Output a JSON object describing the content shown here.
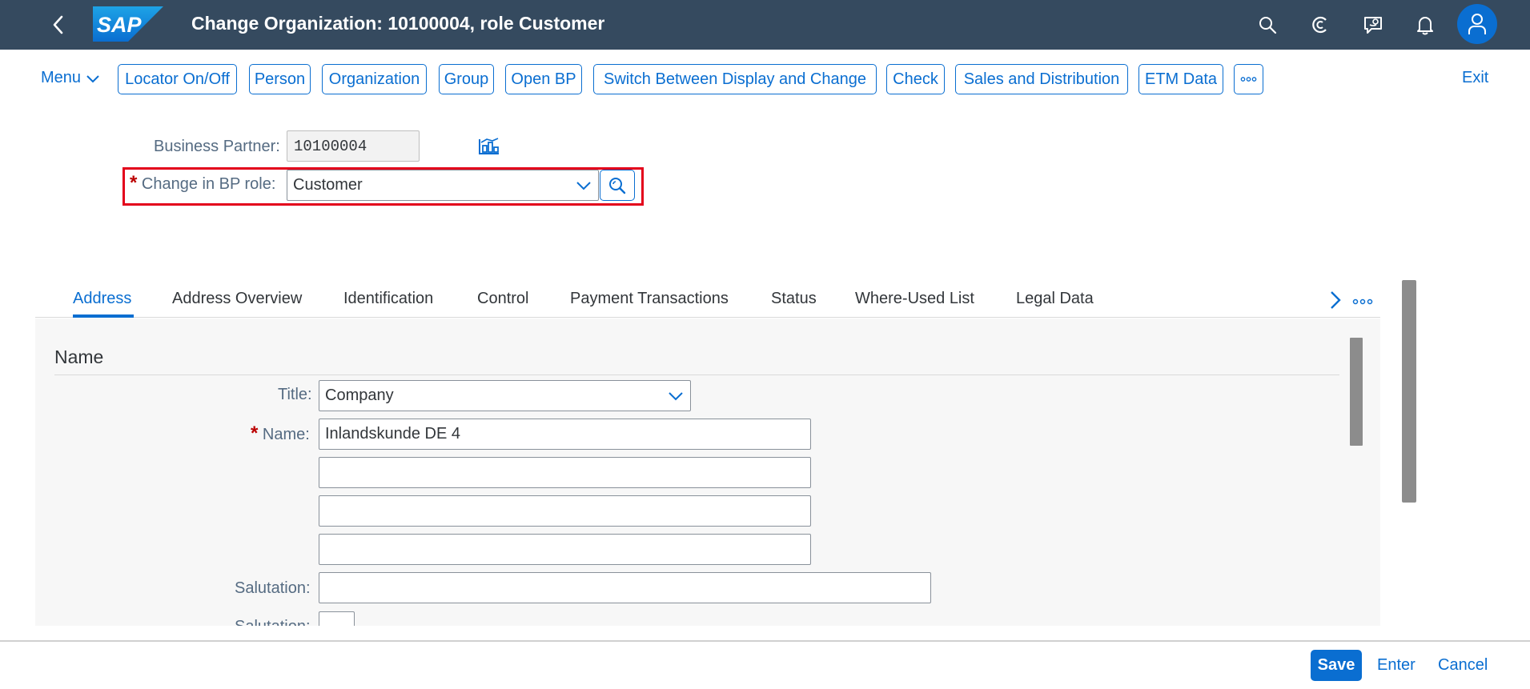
{
  "shell": {
    "title": "Change Organization: 10100004, role Customer",
    "logo_text": "SAP",
    "icons": [
      "back-icon",
      "search-icon",
      "copilot-icon",
      "feedback-icon",
      "notifications-icon",
      "user-icon"
    ]
  },
  "toolbar": {
    "menu_label": "Menu",
    "buttons": [
      "Locator On/Off",
      "Person",
      "Organization",
      "Group",
      "Open BP",
      "Switch Between Display and Change",
      "Check",
      "Sales and Distribution",
      "ETM Data"
    ],
    "more_label": "°°°",
    "exit_label": "Exit"
  },
  "header_form": {
    "bp_label": "Business Partner:",
    "bp_value": "10100004",
    "role_label": "Change in BP role:",
    "role_value": "Customer"
  },
  "tabs": [
    "Address",
    "Address Overview",
    "Identification",
    "Control",
    "Payment Transactions",
    "Status",
    "Where-Used List",
    "Legal Data"
  ],
  "active_tab": "Address",
  "name_section": {
    "title": "Name",
    "title_label": "Title:",
    "title_value": "Company",
    "name_label": "Name:",
    "name_value": "Inlandskunde DE 4",
    "name2_value": "",
    "name3_value": "",
    "name4_value": "",
    "salutation_label": "Salutation:",
    "salutation_value": "",
    "salutation2_label": "Salutation:"
  },
  "footer": {
    "save_label": "Save",
    "enter_label": "Enter",
    "cancel_label": "Cancel"
  },
  "colors": {
    "shell_bg": "#354a5f",
    "accent": "#0a6ed1",
    "highlight": "#e3001b",
    "required": "#bb0000"
  }
}
